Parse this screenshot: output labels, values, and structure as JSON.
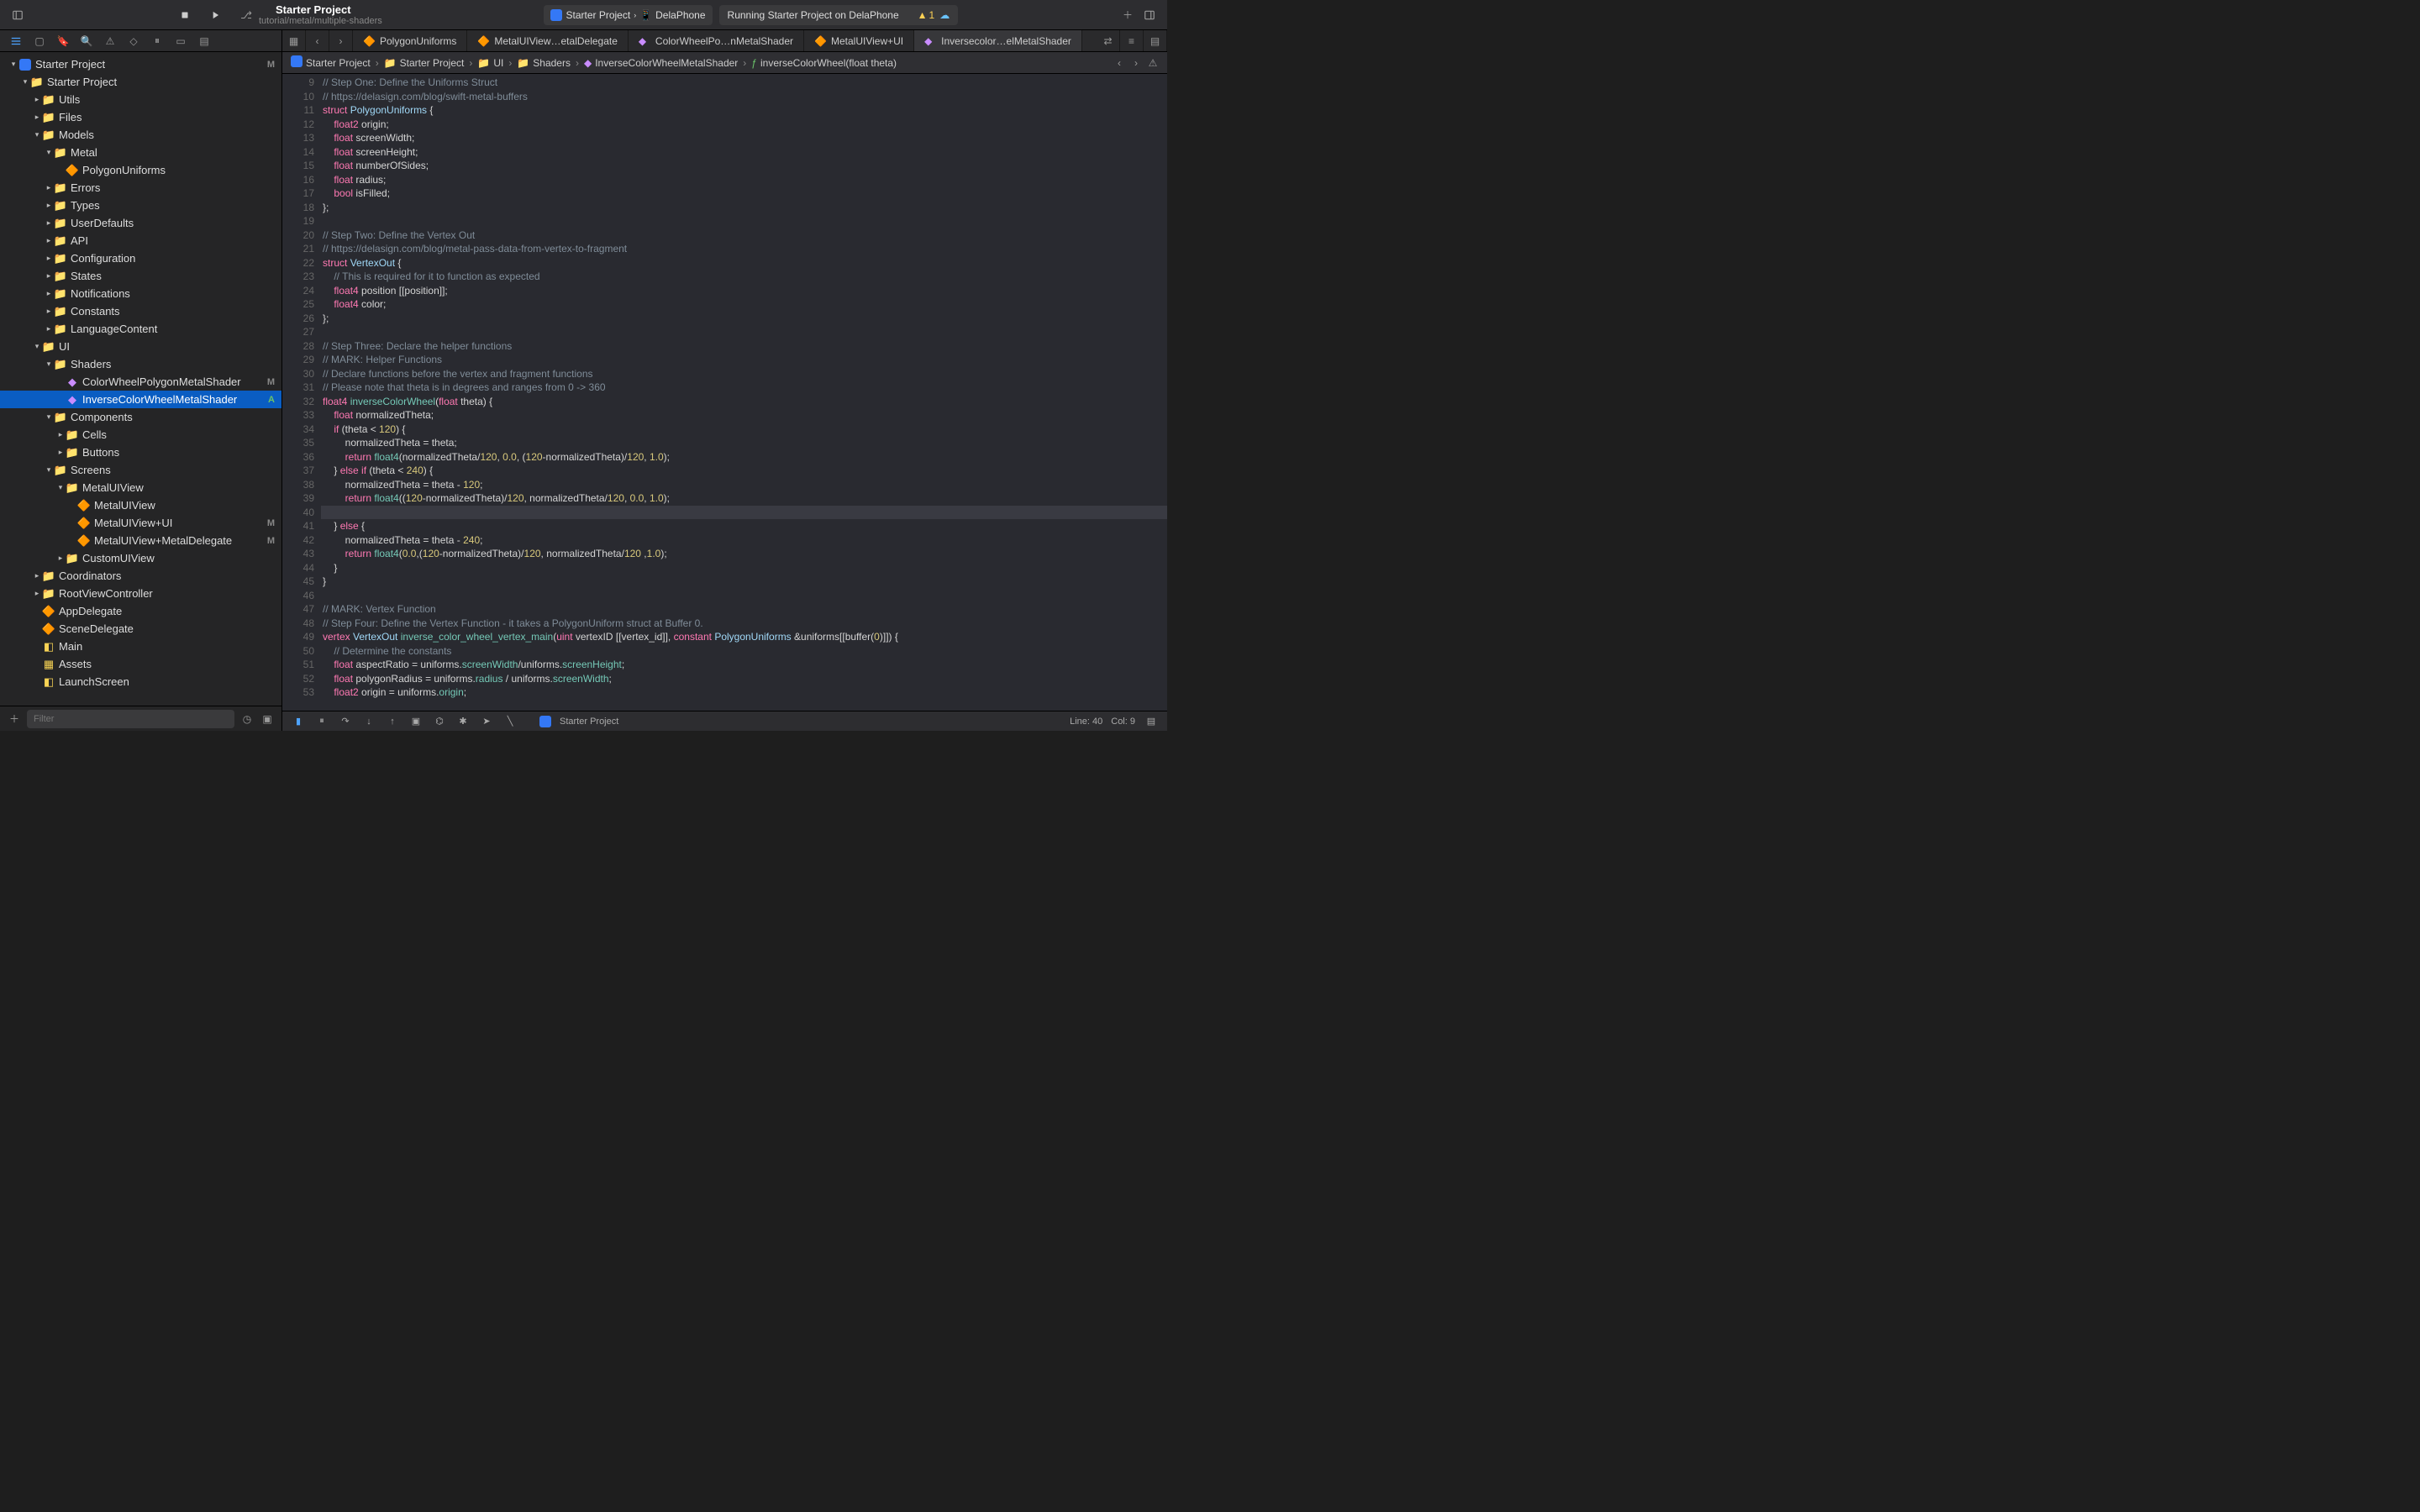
{
  "toolbar": {
    "projectName": "Starter Project",
    "projectPath": "tutorial/metal/multiple-shaders",
    "scheme": {
      "project": "Starter Project",
      "device": "DelaPhone"
    },
    "status": "Running Starter Project on DelaPhone",
    "warnCount": "1"
  },
  "sidebar_tabs_active": 0,
  "navigator": [
    {
      "indent": 0,
      "disclosure": "▾",
      "icon": "proj",
      "label": "Starter Project",
      "status": "M"
    },
    {
      "indent": 1,
      "disclosure": "▾",
      "icon": "folder",
      "label": "Starter Project"
    },
    {
      "indent": 2,
      "disclosure": "▸",
      "icon": "folder",
      "label": "Utils"
    },
    {
      "indent": 2,
      "disclosure": "▸",
      "icon": "folder",
      "label": "Files"
    },
    {
      "indent": 2,
      "disclosure": "▾",
      "icon": "folder",
      "label": "Models"
    },
    {
      "indent": 3,
      "disclosure": "▾",
      "icon": "folder",
      "label": "Metal"
    },
    {
      "indent": 4,
      "disclosure": "",
      "icon": "swift",
      "label": "PolygonUniforms"
    },
    {
      "indent": 3,
      "disclosure": "▸",
      "icon": "folder",
      "label": "Errors"
    },
    {
      "indent": 3,
      "disclosure": "▸",
      "icon": "folder",
      "label": "Types"
    },
    {
      "indent": 3,
      "disclosure": "▸",
      "icon": "folder",
      "label": "UserDefaults"
    },
    {
      "indent": 3,
      "disclosure": "▸",
      "icon": "folder",
      "label": "API"
    },
    {
      "indent": 3,
      "disclosure": "▸",
      "icon": "folder",
      "label": "Configuration"
    },
    {
      "indent": 3,
      "disclosure": "▸",
      "icon": "folder",
      "label": "States"
    },
    {
      "indent": 3,
      "disclosure": "▸",
      "icon": "folder",
      "label": "Notifications"
    },
    {
      "indent": 3,
      "disclosure": "▸",
      "icon": "folder",
      "label": "Constants"
    },
    {
      "indent": 3,
      "disclosure": "▸",
      "icon": "folder",
      "label": "LanguageContent"
    },
    {
      "indent": 2,
      "disclosure": "▾",
      "icon": "folder",
      "label": "UI"
    },
    {
      "indent": 3,
      "disclosure": "▾",
      "icon": "folder",
      "label": "Shaders"
    },
    {
      "indent": 4,
      "disclosure": "",
      "icon": "metal",
      "label": "ColorWheelPolygonMetalShader",
      "status": "M"
    },
    {
      "indent": 4,
      "disclosure": "",
      "icon": "metal",
      "label": "InverseColorWheelMetalShader",
      "status": "A",
      "selected": true
    },
    {
      "indent": 3,
      "disclosure": "▾",
      "icon": "folder",
      "label": "Components"
    },
    {
      "indent": 4,
      "disclosure": "▸",
      "icon": "folder",
      "label": "Cells"
    },
    {
      "indent": 4,
      "disclosure": "▸",
      "icon": "folder",
      "label": "Buttons"
    },
    {
      "indent": 3,
      "disclosure": "▾",
      "icon": "folder",
      "label": "Screens"
    },
    {
      "indent": 4,
      "disclosure": "▾",
      "icon": "folder",
      "label": "MetalUIView"
    },
    {
      "indent": 5,
      "disclosure": "",
      "icon": "swift",
      "label": "MetalUIView"
    },
    {
      "indent": 5,
      "disclosure": "",
      "icon": "swift",
      "label": "MetalUIView+UI",
      "status": "M"
    },
    {
      "indent": 5,
      "disclosure": "",
      "icon": "swift",
      "label": "MetalUIView+MetalDelegate",
      "status": "M"
    },
    {
      "indent": 4,
      "disclosure": "▸",
      "icon": "folder",
      "label": "CustomUIView"
    },
    {
      "indent": 2,
      "disclosure": "▸",
      "icon": "folder",
      "label": "Coordinators"
    },
    {
      "indent": 2,
      "disclosure": "▸",
      "icon": "folder",
      "label": "RootViewController"
    },
    {
      "indent": 2,
      "disclosure": "",
      "icon": "swift",
      "label": "AppDelegate"
    },
    {
      "indent": 2,
      "disclosure": "",
      "icon": "swift",
      "label": "SceneDelegate"
    },
    {
      "indent": 2,
      "disclosure": "",
      "icon": "xib",
      "label": "Main"
    },
    {
      "indent": 2,
      "disclosure": "",
      "icon": "assets",
      "label": "Assets"
    },
    {
      "indent": 2,
      "disclosure": "",
      "icon": "xib",
      "label": "LaunchScreen"
    }
  ],
  "filter_placeholder": "Filter",
  "tabs": [
    {
      "icon": "swift",
      "label": "PolygonUniforms"
    },
    {
      "icon": "swift",
      "label": "MetalUIView…etalDelegate"
    },
    {
      "icon": "metal",
      "label": "ColorWheelPo…nMetalShader"
    },
    {
      "icon": "swift",
      "label": "MetalUIView+UI"
    },
    {
      "icon": "metal",
      "label": "Inversecolor…elMetalShader",
      "active": true
    }
  ],
  "breadcrumb": [
    {
      "icon": "proj",
      "label": "Starter Project"
    },
    {
      "icon": "folder",
      "label": "Starter Project"
    },
    {
      "icon": "folder",
      "label": "UI"
    },
    {
      "icon": "folder",
      "label": "Shaders"
    },
    {
      "icon": "metal",
      "label": "InverseColorWheelMetalShader"
    },
    {
      "icon": "fn",
      "label": "inverseColorWheel(float theta)"
    }
  ],
  "code_start": 9,
  "code_lines": [
    {
      "n": 9,
      "raw": "// Step One: Define the Uniforms Struct",
      "cls": "cmt"
    },
    {
      "n": 10,
      "raw": "// https://delasign.com/blog/swift-metal-buffers",
      "cls": "cmt"
    },
    {
      "n": 11,
      "html": "<span class='tok-kw'>struct</span> <span class='tok-type'>PolygonUniforms</span> {"
    },
    {
      "n": 12,
      "html": "    <span class='tok-kw'>float2</span> origin;"
    },
    {
      "n": 13,
      "html": "    <span class='tok-kw'>float</span> screenWidth;"
    },
    {
      "n": 14,
      "html": "    <span class='tok-kw'>float</span> screenHeight;"
    },
    {
      "n": 15,
      "html": "    <span class='tok-kw'>float</span> numberOfSides;"
    },
    {
      "n": 16,
      "html": "    <span class='tok-kw'>float</span> radius;"
    },
    {
      "n": 17,
      "html": "    <span class='tok-kw'>bool</span> isFilled;"
    },
    {
      "n": 18,
      "html": "};"
    },
    {
      "n": 19,
      "html": ""
    },
    {
      "n": 20,
      "raw": "// Step Two: Define the Vertex Out",
      "cls": "cmt"
    },
    {
      "n": 21,
      "raw": "// https://delasign.com/blog/metal-pass-data-from-vertex-to-fragment",
      "cls": "cmt"
    },
    {
      "n": 22,
      "html": "<span class='tok-kw'>struct</span> <span class='tok-type'>VertexOut</span> {"
    },
    {
      "n": 23,
      "raw": "    // This is required for it to function as expected",
      "cls": "cmt"
    },
    {
      "n": 24,
      "html": "    <span class='tok-kw'>float4</span> position [[position]];"
    },
    {
      "n": 25,
      "html": "    <span class='tok-kw'>float4</span> color;"
    },
    {
      "n": 26,
      "html": "};"
    },
    {
      "n": 27,
      "html": ""
    },
    {
      "n": 28,
      "raw": "// Step Three: Declare the helper functions",
      "cls": "cmt"
    },
    {
      "n": 29,
      "raw": "// MARK: Helper Functions",
      "cls": "cmt"
    },
    {
      "n": 30,
      "raw": "// Declare functions before the vertex and fragment functions",
      "cls": "cmt"
    },
    {
      "n": 31,
      "raw": "// Please note that theta is in degrees and ranges from 0 -> 360",
      "cls": "cmt"
    },
    {
      "n": 32,
      "html": "<span class='tok-kw'>float4</span> <span class='tok-fn'>inverseColorWheel</span>(<span class='tok-kw'>float</span> theta) {"
    },
    {
      "n": 33,
      "html": "    <span class='tok-kw'>float</span> normalizedTheta;"
    },
    {
      "n": 34,
      "html": "    <span class='tok-kw'>if</span> (theta &lt; <span class='tok-num'>120</span>) {"
    },
    {
      "n": 35,
      "html": "        normalizedTheta = theta;"
    },
    {
      "n": 36,
      "html": "        <span class='tok-kw'>return</span> <span class='tok-fn'>float4</span>(normalizedTheta/<span class='tok-num'>120</span>, <span class='tok-num'>0.0</span>, (<span class='tok-num'>120</span>-normalizedTheta)/<span class='tok-num'>120</span>, <span class='tok-num'>1.0</span>);"
    },
    {
      "n": 37,
      "html": "    } <span class='tok-kw'>else</span> <span class='tok-kw'>if</span> (theta &lt; <span class='tok-num'>240</span>) {"
    },
    {
      "n": 38,
      "html": "        normalizedTheta = theta - <span class='tok-num'>120</span>;"
    },
    {
      "n": 39,
      "html": "        <span class='tok-kw'>return</span> <span class='tok-fn'>float4</span>((<span class='tok-num'>120</span>-normalizedTheta)/<span class='tok-num'>120</span>, normalizedTheta/<span class='tok-num'>120</span>, <span class='tok-num'>0.0</span>, <span class='tok-num'>1.0</span>);"
    },
    {
      "n": 40,
      "html": "",
      "cursor": true
    },
    {
      "n": 41,
      "html": "    } <span class='tok-kw'>else</span> {"
    },
    {
      "n": 42,
      "html": "        normalizedTheta = theta - <span class='tok-num'>240</span>;"
    },
    {
      "n": 43,
      "html": "        <span class='tok-kw'>return</span> <span class='tok-fn'>float4</span>(<span class='tok-num'>0.0</span>,(<span class='tok-num'>120</span>-normalizedTheta)/<span class='tok-num'>120</span>, normalizedTheta/<span class='tok-num'>120</span> ,<span class='tok-num'>1.0</span>);"
    },
    {
      "n": 44,
      "html": "    }"
    },
    {
      "n": 45,
      "html": "}"
    },
    {
      "n": 46,
      "html": ""
    },
    {
      "n": 47,
      "raw": "// MARK: Vertex Function",
      "cls": "cmt"
    },
    {
      "n": 48,
      "raw": "// Step Four: Define the Vertex Function - it takes a PolygonUniform struct at Buffer 0.",
      "cls": "cmt"
    },
    {
      "n": 49,
      "html": "<span class='tok-kw'>vertex</span> <span class='tok-type'>VertexOut</span> <span class='tok-fn'>inverse_color_wheel_vertex_main</span>(<span class='tok-kw'>uint</span> vertexID [[vertex_id]], <span class='tok-kw'>constant</span> <span class='tok-type'>PolygonUniforms</span> &amp;uniforms[[buffer(<span class='tok-num'>0</span>)]]) {"
    },
    {
      "n": 50,
      "raw": "    // Determine the constants",
      "cls": "cmt"
    },
    {
      "n": 51,
      "html": "    <span class='tok-kw'>float</span> aspectRatio = uniforms.<span class='tok-prop'>screenWidth</span>/uniforms.<span class='tok-prop'>screenHeight</span>;"
    },
    {
      "n": 52,
      "html": "    <span class='tok-kw'>float</span> polygonRadius = uniforms.<span class='tok-prop'>radius</span> / uniforms.<span class='tok-prop'>screenWidth</span>;"
    },
    {
      "n": 53,
      "html": "    <span class='tok-kw'>float2</span> origin = uniforms.<span class='tok-prop'>origin</span>;"
    }
  ],
  "debug_target": "Starter Project",
  "cursor_pos": {
    "line": "Line: 40",
    "col": "Col: 9"
  }
}
